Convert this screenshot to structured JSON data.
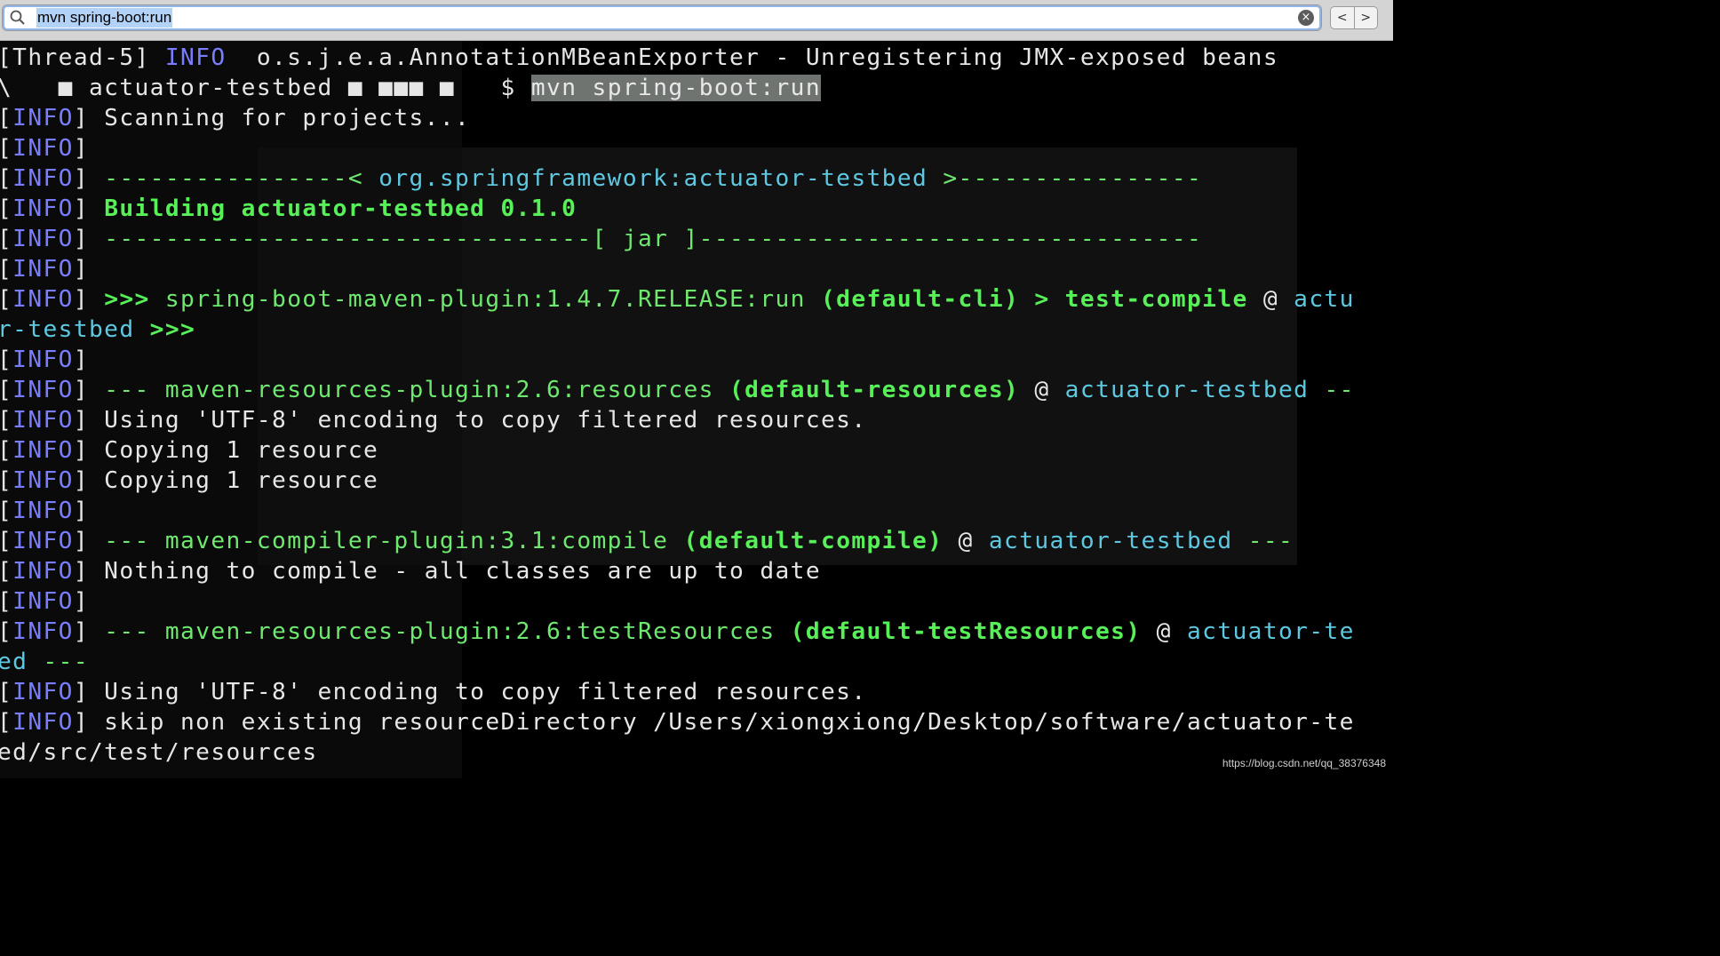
{
  "search": {
    "value": "mvn spring-boot:run",
    "clear_icon": "clear-circle-icon",
    "icon": "search-icon"
  },
  "nav": {
    "back": "<",
    "forward": ">"
  },
  "lines": [
    {
      "segs": [
        {
          "t": "[Thread-5] ",
          "c": "w"
        },
        {
          "t": "INFO",
          "c": "p"
        },
        {
          "t": "  o.s.j.e.a.AnnotationMBeanExporter - Unregistering JMX-exposed beans",
          "c": "w"
        }
      ]
    },
    {
      "segs": [
        {
          "t": "\\   ",
          "c": "w"
        },
        {
          "t": "■",
          "c": "w"
        },
        {
          "t": " actuator-testbed ",
          "c": "w"
        },
        {
          "t": "■ ■■■ ■",
          "c": "w"
        },
        {
          "t": "   $ ",
          "c": "w"
        },
        {
          "t": "mvn spring-boot:run",
          "c": "hl"
        }
      ]
    },
    {
      "segs": [
        {
          "t": "[",
          "c": "w"
        },
        {
          "t": "INFO",
          "c": "p"
        },
        {
          "t": "] Scanning for projects...",
          "c": "w"
        }
      ]
    },
    {
      "segs": [
        {
          "t": "[",
          "c": "w"
        },
        {
          "t": "INFO",
          "c": "p"
        },
        {
          "t": "]",
          "c": "w"
        }
      ]
    },
    {
      "segs": [
        {
          "t": "[",
          "c": "w"
        },
        {
          "t": "INFO",
          "c": "p"
        },
        {
          "t": "] ",
          "c": "w"
        },
        {
          "t": "----------------< ",
          "c": "g"
        },
        {
          "t": "org.springframework:actuator-testbed",
          "c": "c"
        },
        {
          "t": " >----------------",
          "c": "g"
        }
      ]
    },
    {
      "segs": [
        {
          "t": "[",
          "c": "w"
        },
        {
          "t": "INFO",
          "c": "p"
        },
        {
          "t": "] ",
          "c": "w"
        },
        {
          "t": "Building actuator-testbed 0.1.0",
          "c": "gb"
        }
      ]
    },
    {
      "segs": [
        {
          "t": "[",
          "c": "w"
        },
        {
          "t": "INFO",
          "c": "p"
        },
        {
          "t": "] ",
          "c": "w"
        },
        {
          "t": "--------------------------------[ jar ]---------------------------------",
          "c": "g"
        }
      ]
    },
    {
      "segs": [
        {
          "t": "[",
          "c": "w"
        },
        {
          "t": "INFO",
          "c": "p"
        },
        {
          "t": "]",
          "c": "w"
        }
      ]
    },
    {
      "segs": [
        {
          "t": "[",
          "c": "w"
        },
        {
          "t": "INFO",
          "c": "p"
        },
        {
          "t": "] ",
          "c": "w"
        },
        {
          "t": ">>> ",
          "c": "gb"
        },
        {
          "t": "spring-boot-maven-plugin:1.4.7.RELEASE:run",
          "c": "g"
        },
        {
          "t": " (default-cli) > test-compile",
          "c": "gb"
        },
        {
          "t": " @ ",
          "c": "w"
        },
        {
          "t": "actu",
          "c": "c"
        }
      ]
    },
    {
      "segs": [
        {
          "t": "r-testbed",
          "c": "c"
        },
        {
          "t": " >>>",
          "c": "gb"
        }
      ]
    },
    {
      "segs": [
        {
          "t": "[",
          "c": "w"
        },
        {
          "t": "INFO",
          "c": "p"
        },
        {
          "t": "]",
          "c": "w"
        }
      ]
    },
    {
      "segs": [
        {
          "t": "[",
          "c": "w"
        },
        {
          "t": "INFO",
          "c": "p"
        },
        {
          "t": "] ",
          "c": "w"
        },
        {
          "t": "--- ",
          "c": "g"
        },
        {
          "t": "maven-resources-plugin:2.6:resources",
          "c": "g"
        },
        {
          "t": " (default-resources)",
          "c": "gb"
        },
        {
          "t": " @ ",
          "c": "w"
        },
        {
          "t": "actuator-testbed",
          "c": "c"
        },
        {
          "t": " --",
          "c": "g"
        }
      ]
    },
    {
      "segs": [
        {
          "t": "[",
          "c": "w"
        },
        {
          "t": "INFO",
          "c": "p"
        },
        {
          "t": "] Using 'UTF-8' encoding to copy filtered resources.",
          "c": "w"
        }
      ]
    },
    {
      "segs": [
        {
          "t": "[",
          "c": "w"
        },
        {
          "t": "INFO",
          "c": "p"
        },
        {
          "t": "] Copying 1 resource",
          "c": "w"
        }
      ]
    },
    {
      "segs": [
        {
          "t": "[",
          "c": "w"
        },
        {
          "t": "INFO",
          "c": "p"
        },
        {
          "t": "] Copying 1 resource",
          "c": "w"
        }
      ]
    },
    {
      "segs": [
        {
          "t": "[",
          "c": "w"
        },
        {
          "t": "INFO",
          "c": "p"
        },
        {
          "t": "]",
          "c": "w"
        }
      ]
    },
    {
      "segs": [
        {
          "t": "[",
          "c": "w"
        },
        {
          "t": "INFO",
          "c": "p"
        },
        {
          "t": "] ",
          "c": "w"
        },
        {
          "t": "--- ",
          "c": "g"
        },
        {
          "t": "maven-compiler-plugin:3.1:compile",
          "c": "g"
        },
        {
          "t": " (default-compile)",
          "c": "gb"
        },
        {
          "t": " @ ",
          "c": "w"
        },
        {
          "t": "actuator-testbed",
          "c": "c"
        },
        {
          "t": " ---",
          "c": "g"
        }
      ]
    },
    {
      "segs": [
        {
          "t": "[",
          "c": "w"
        },
        {
          "t": "INFO",
          "c": "p"
        },
        {
          "t": "] Nothing to compile - all classes are up to date",
          "c": "w"
        }
      ]
    },
    {
      "segs": [
        {
          "t": "[",
          "c": "w"
        },
        {
          "t": "INFO",
          "c": "p"
        },
        {
          "t": "]",
          "c": "w"
        }
      ]
    },
    {
      "segs": [
        {
          "t": "[",
          "c": "w"
        },
        {
          "t": "INFO",
          "c": "p"
        },
        {
          "t": "] ",
          "c": "w"
        },
        {
          "t": "--- ",
          "c": "g"
        },
        {
          "t": "maven-resources-plugin:2.6:testResources",
          "c": "g"
        },
        {
          "t": " (default-testResources)",
          "c": "gb"
        },
        {
          "t": " @ ",
          "c": "w"
        },
        {
          "t": "actuator-te",
          "c": "c"
        }
      ]
    },
    {
      "segs": [
        {
          "t": "ed",
          "c": "c"
        },
        {
          "t": " ---",
          "c": "g"
        }
      ]
    },
    {
      "segs": [
        {
          "t": "[",
          "c": "w"
        },
        {
          "t": "INFO",
          "c": "p"
        },
        {
          "t": "] Using 'UTF-8' encoding to copy filtered resources.",
          "c": "w"
        }
      ]
    },
    {
      "segs": [
        {
          "t": "[",
          "c": "w"
        },
        {
          "t": "INFO",
          "c": "p"
        },
        {
          "t": "] skip non existing resourceDirectory /Users/xiongxiong/Desktop/software/actuator-te",
          "c": "w"
        }
      ]
    },
    {
      "segs": [
        {
          "t": "ed/src/test/resources",
          "c": "w"
        }
      ]
    }
  ],
  "watermark": "https://blog.csdn.net/qq_38376348"
}
